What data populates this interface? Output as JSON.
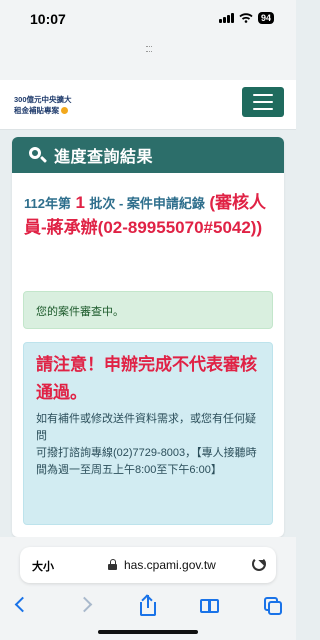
{
  "status_bar": {
    "time": "10:07",
    "battery": "94"
  },
  "site": {
    "logo_line1": "300億元中央擴大",
    "logo_line2": "租金補貼專案"
  },
  "card": {
    "title": "進度查詢結果",
    "record_prefix": "112年第",
    "record_number": "1",
    "record_middle": "批次 - 案件申請紀錄",
    "record_reviewer": "(審核人員-蔣承辦(02-89955070#5042))",
    "status_message": "您的案件審查中。",
    "notice_title": "請注意！申辦完成不代表審核通過。",
    "notice_body_1": "如有補件或修改送件資料需求，或您有任何疑問",
    "notice_body_2": "可撥打諮詢專線(02)7729-8003，【專人接聽時間為週一至周五上午8:00至下午6:00】"
  },
  "browser": {
    "text_size_label": "大小",
    "url": "has.cpami.gov.tw"
  },
  "colors": {
    "header_teal": "#2c6e6a",
    "menu_green": "#1f6b5e",
    "accent_red": "#e02245",
    "link_blue": "#1a73e8"
  },
  "icons": [
    "signal-icon",
    "wifi-icon",
    "battery-icon",
    "menu-icon",
    "search-icon",
    "lock-icon",
    "reload-icon",
    "back-icon",
    "forward-icon",
    "share-icon",
    "bookmarks-icon",
    "tabs-icon"
  ]
}
